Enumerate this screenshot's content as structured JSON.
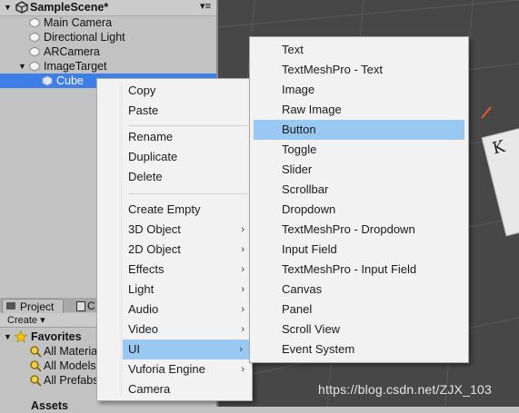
{
  "hierarchy": {
    "scene_title": "SampleScene*",
    "menu_glyph": "▾≡",
    "items": [
      {
        "label": "Main Camera"
      },
      {
        "label": "Directional Light"
      },
      {
        "label": "ARCamera"
      },
      {
        "label": "ImageTarget"
      },
      {
        "label": "Cube"
      }
    ]
  },
  "project": {
    "tab_project": "Project",
    "tab_console": "C",
    "create_label": "Create ▾",
    "favorites_label": "Favorites",
    "favorite_items": [
      {
        "label": "All Materia"
      },
      {
        "label": "All Models"
      },
      {
        "label": "All Prefabs"
      }
    ],
    "assets_label": "Assets"
  },
  "context_menu": {
    "items": [
      {
        "label": "Copy"
      },
      {
        "label": "Paste"
      },
      {
        "label": "Rename"
      },
      {
        "label": "Duplicate"
      },
      {
        "label": "Delete"
      },
      {
        "label": "Create Empty"
      },
      {
        "label": "3D Object"
      },
      {
        "label": "2D Object"
      },
      {
        "label": "Effects"
      },
      {
        "label": "Light"
      },
      {
        "label": "Audio"
      },
      {
        "label": "Video"
      },
      {
        "label": "UI"
      },
      {
        "label": "Vuforia Engine"
      },
      {
        "label": "Camera"
      }
    ],
    "submenu_arrow": "›"
  },
  "ui_submenu": {
    "items": [
      {
        "label": "Text"
      },
      {
        "label": "TextMeshPro - Text"
      },
      {
        "label": "Image"
      },
      {
        "label": "Raw Image"
      },
      {
        "label": "Button"
      },
      {
        "label": "Toggle"
      },
      {
        "label": "Slider"
      },
      {
        "label": "Scrollbar"
      },
      {
        "label": "Dropdown"
      },
      {
        "label": "TextMeshPro - Dropdown"
      },
      {
        "label": "Input Field"
      },
      {
        "label": "TextMeshPro - Input Field"
      },
      {
        "label": "Canvas"
      },
      {
        "label": "Panel"
      },
      {
        "label": "Scroll View"
      },
      {
        "label": "Event System"
      }
    ]
  },
  "scene_view": {
    "card_text": "K"
  },
  "watermark": "https://blog.csdn.net/ZJX_103",
  "colors": {
    "selection": "#3d7fe6",
    "menu_highlight": "#99c9f2",
    "menu_bg": "#f2f2f2"
  }
}
